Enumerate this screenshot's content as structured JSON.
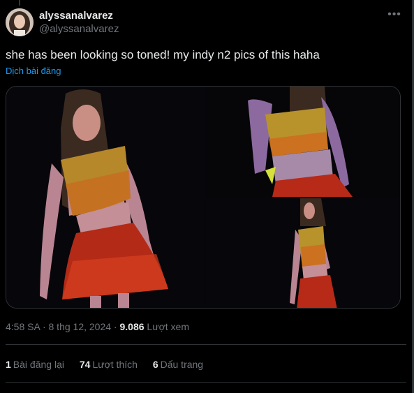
{
  "user": {
    "display_name": "alyssanalvarez",
    "handle": "@alyssanalvarez"
  },
  "tweet": {
    "text": "she has been looking so toned! my indy n2 pics of this haha",
    "translate_label": "Dịch bài đăng"
  },
  "meta": {
    "time": "4:58 SA",
    "separator": "·",
    "date": "8 thg 12, 2024",
    "views_count": "9.086",
    "views_label": "Lượt xem"
  },
  "stats": {
    "reposts_count": "1",
    "reposts_label": "Bài đăng lại",
    "likes_count": "74",
    "likes_label": "Lượt thích",
    "bookmarks_count": "6",
    "bookmarks_label": "Dấu trang"
  },
  "icons": {
    "more": "more-horizontal-icon"
  },
  "colors": {
    "background": "#000000",
    "text_primary": "#e7e9ea",
    "text_secondary": "#71767b",
    "link": "#1d9bf0",
    "border": "#2f3336"
  }
}
